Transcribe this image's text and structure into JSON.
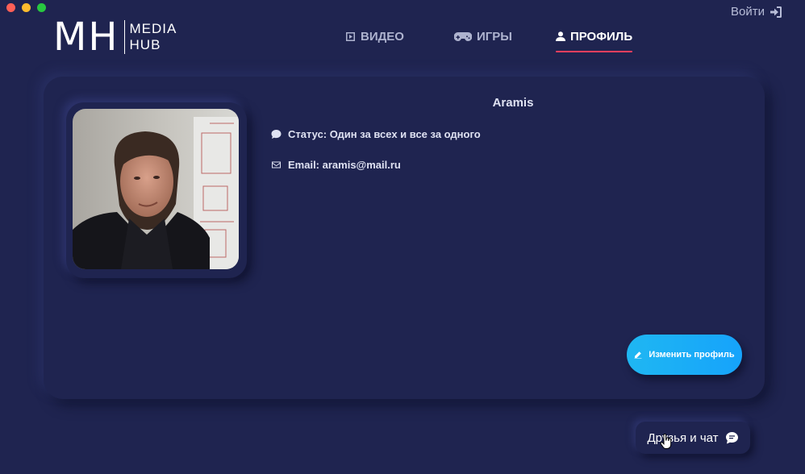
{
  "window": {
    "controls": [
      "close",
      "minimize",
      "maximize"
    ]
  },
  "header": {
    "logo": {
      "mark": "MH",
      "line1": "MEDIA",
      "line2": "HUB"
    },
    "login": {
      "label": "Войти",
      "icon": "sign-in-icon"
    },
    "nav": [
      {
        "label": "ВИДЕО",
        "icon": "play-square-icon",
        "active": false
      },
      {
        "label": "ИГРЫ",
        "icon": "gamepad-icon",
        "active": false
      },
      {
        "label": "ПРОФИЛЬ",
        "icon": "user-icon",
        "active": true
      }
    ],
    "accent_color": "#ff3f5e"
  },
  "profile": {
    "username": "Aramis",
    "status": "Статус: Один за всех и все за одного",
    "email": "Email: aramis@mail.ru",
    "edit_button": "Изменить профиль",
    "button_color": "#1fb7f2"
  },
  "chat": {
    "label": "Друзья и чат",
    "icon": "chat-bubble-icon"
  },
  "colors": {
    "background": "#1f2450",
    "text": "#dfe2f2"
  }
}
